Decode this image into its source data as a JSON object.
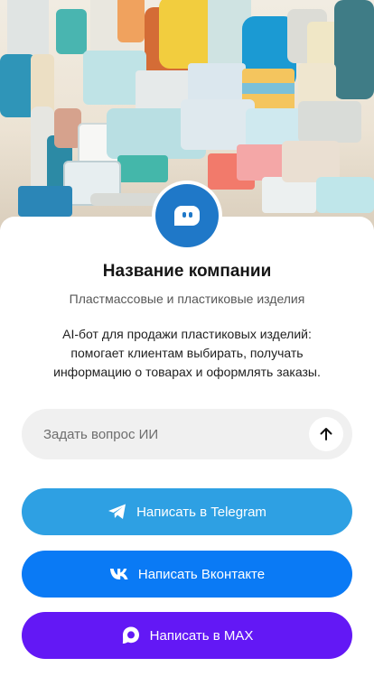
{
  "company": {
    "name": "Название компании",
    "category": "Пластмассовые и пластиковые изделия",
    "description": "AI-бот для продажи пластиковых изделий: помогает клиентам выбирать, получать информацию о товарах и оформлять заказы."
  },
  "ask": {
    "placeholder": "Задать вопрос ИИ"
  },
  "buttons": {
    "telegram": "Написать в Telegram",
    "vk": "Написать Вконтакте",
    "max": "Написать в MAX"
  },
  "colors": {
    "avatar": "#1f78c8",
    "telegram": "#2ea0e3",
    "vk": "#0a7af5",
    "max": "#6318f5",
    "input_bg": "#f0f0f0"
  },
  "icons": {
    "avatar": "chat-bot-icon",
    "send": "arrow-up-icon",
    "telegram": "telegram-icon",
    "vk": "vk-icon",
    "max": "max-messenger-icon"
  }
}
